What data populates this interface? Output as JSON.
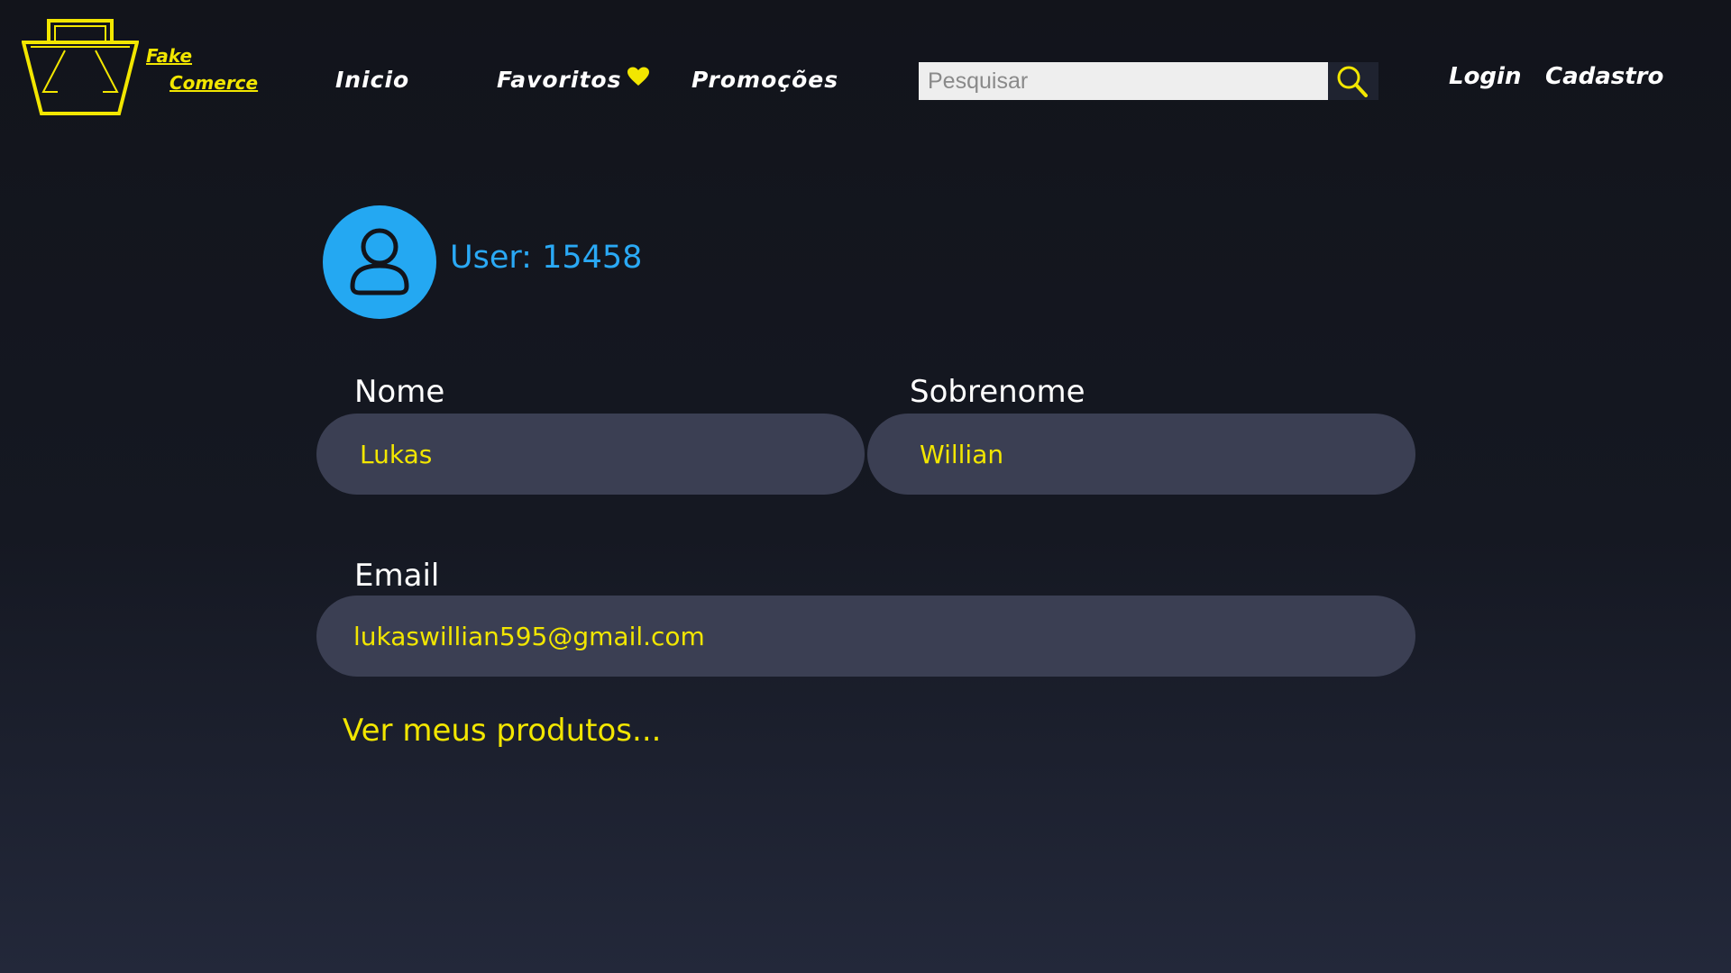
{
  "header": {
    "logo": {
      "line1": "Fake",
      "line2": "Comerce",
      "icon": "shopping-bag-logo-icon"
    },
    "nav": {
      "inicio": "Inicio",
      "favoritos": "Favoritos",
      "favoritos_icon": "heart-icon",
      "promocoes": "Promoções"
    },
    "search": {
      "placeholder": "Pesquisar",
      "value": "",
      "button_icon": "search-icon"
    },
    "auth": {
      "login": "Login",
      "cadastro": "Cadastro"
    }
  },
  "profile": {
    "avatar_icon": "user-icon",
    "user_label": "User: 15458",
    "fields": {
      "nome": {
        "label": "Nome",
        "value": "Lukas"
      },
      "sobrenome": {
        "label": "Sobrenome",
        "value": "Willian"
      },
      "email": {
        "label": "Email",
        "value": "lukaswillian595@gmail.com"
      }
    },
    "products_link": "Ver meus produtos..."
  },
  "colors": {
    "background_top": "#12141b",
    "background_bottom": "#23283a",
    "accent_yellow": "#f2e600",
    "accent_blue": "#24a8f2",
    "field_background": "#3b3f53"
  }
}
